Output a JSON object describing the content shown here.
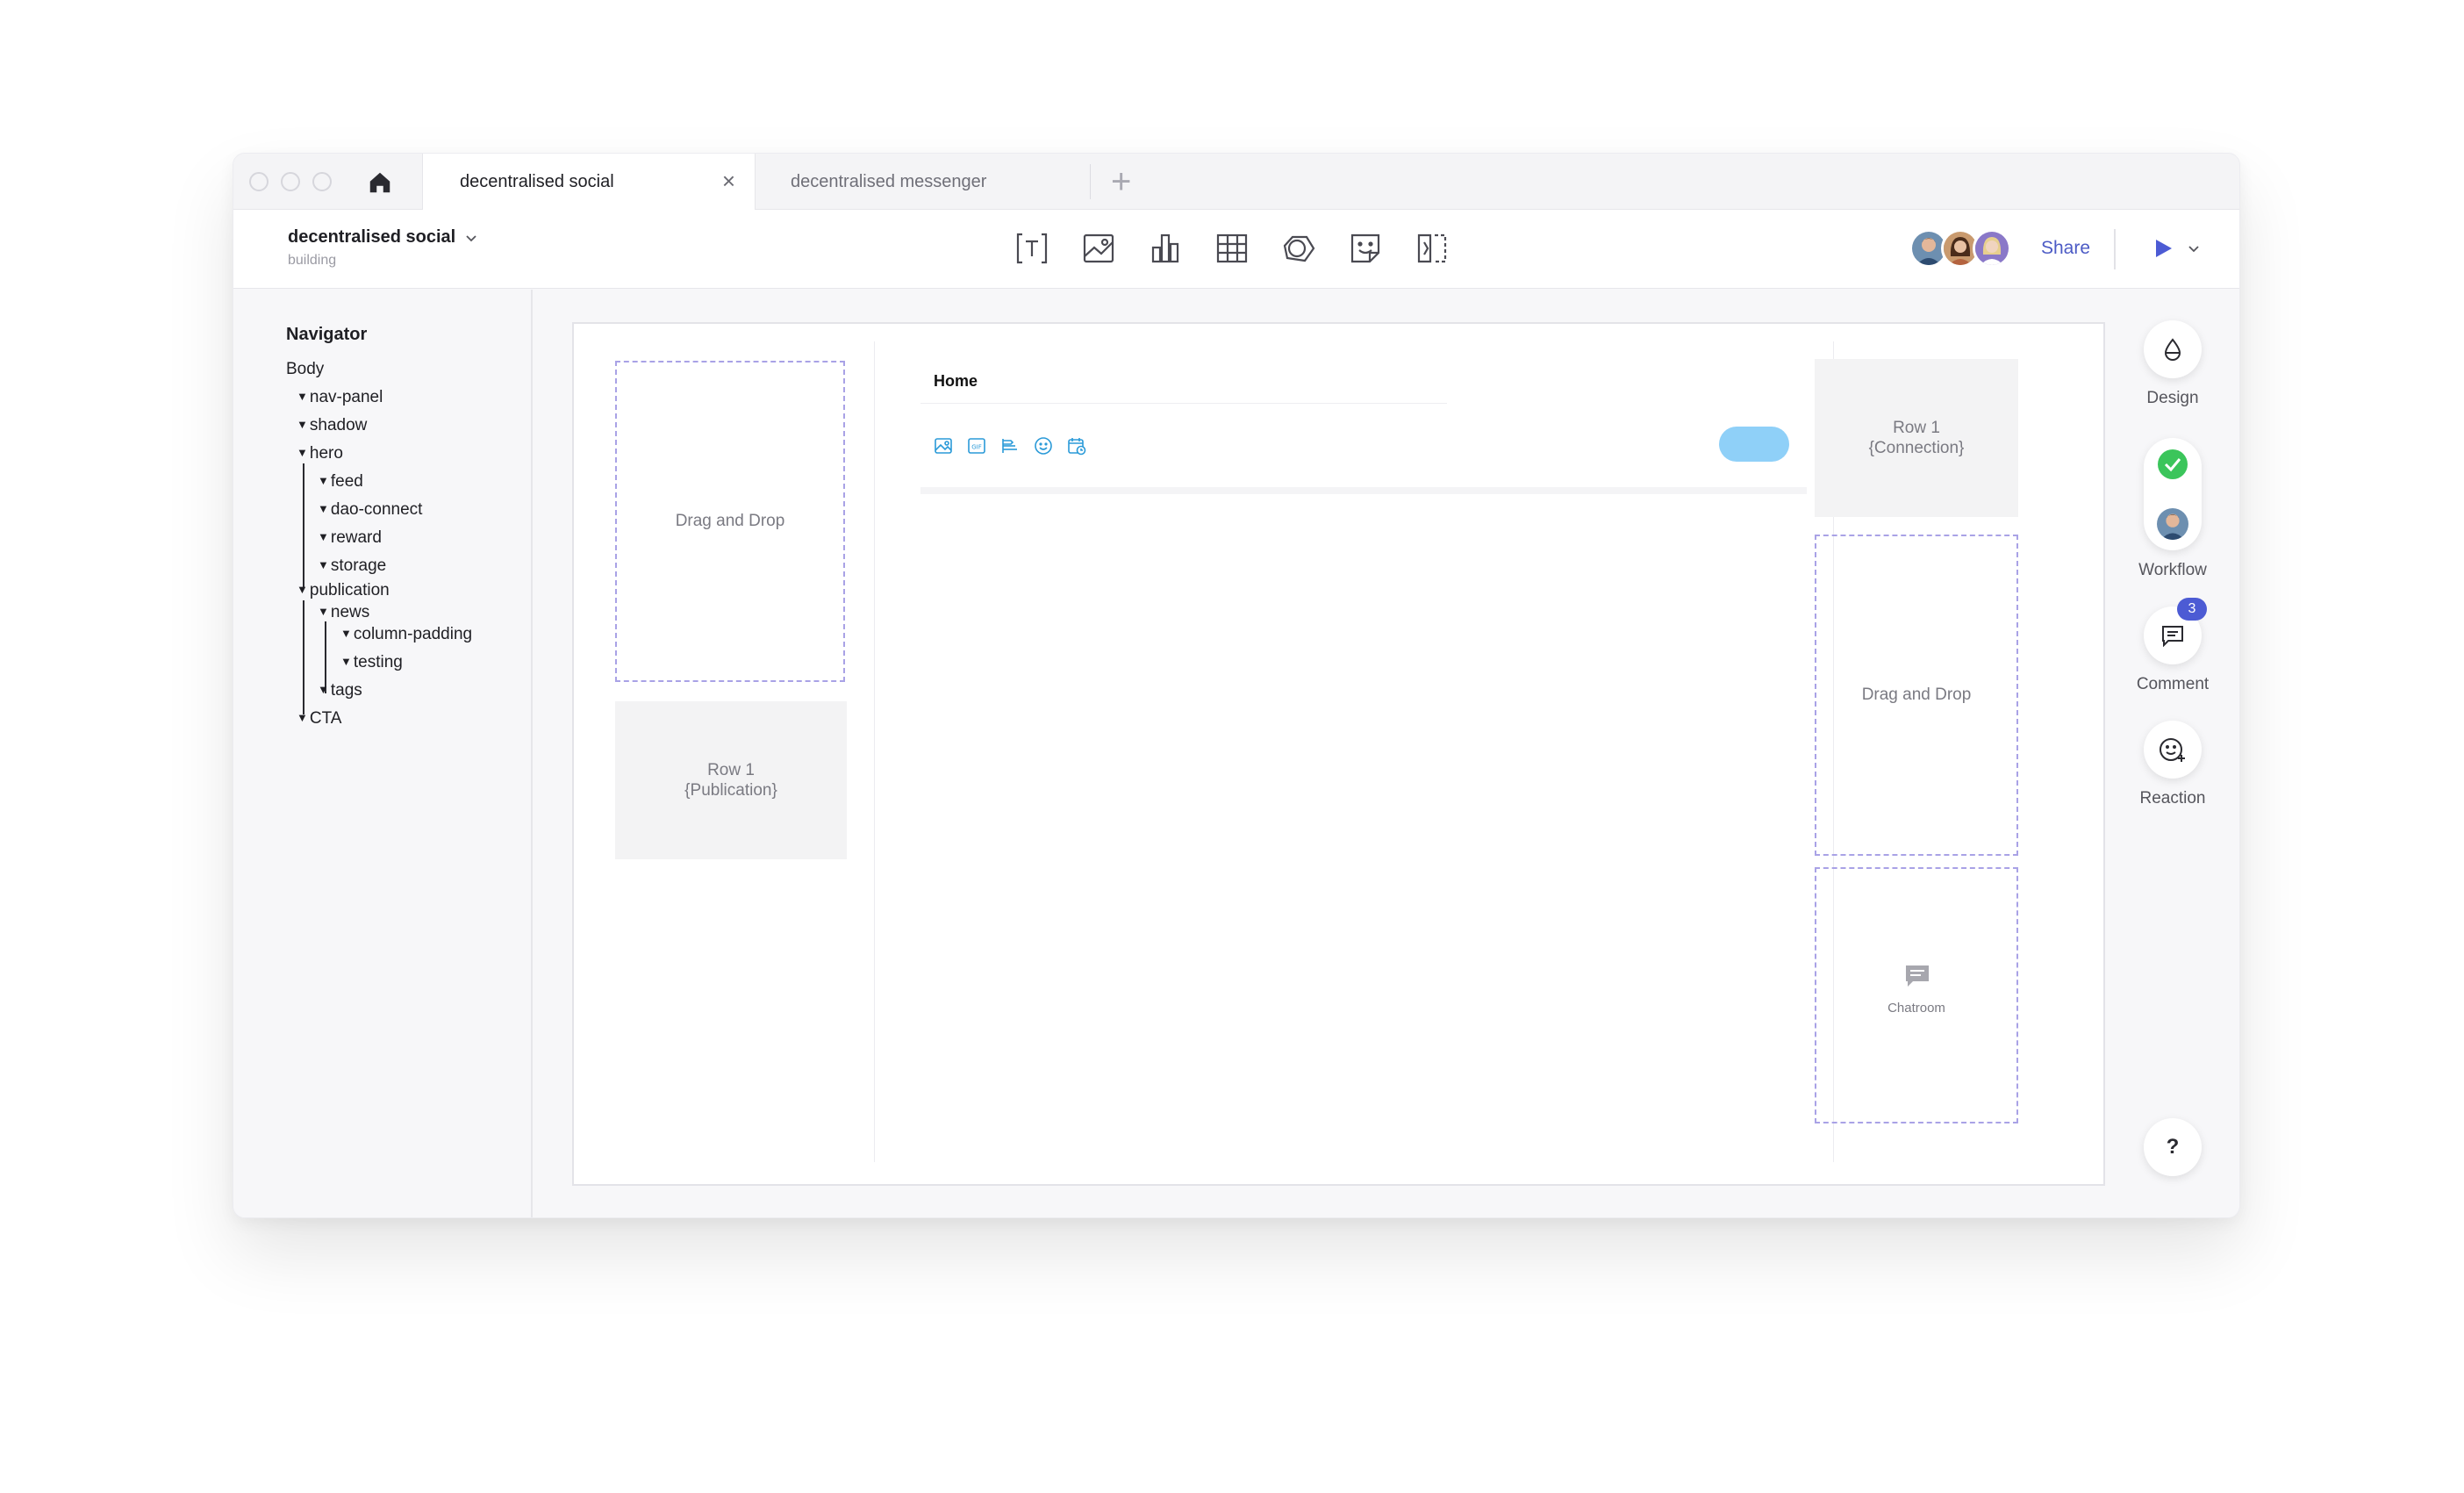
{
  "tabs": {
    "active_label": "decentralised social",
    "inactive_label": "decentralised messenger"
  },
  "project": {
    "title": "decentralised social",
    "subtitle": "building"
  },
  "toolbar": {
    "tools": [
      "text-tool-icon",
      "image-tool-icon",
      "chart-tool-icon",
      "table-tool-icon",
      "shape-tool-icon",
      "sticker-tool-icon",
      "component-tool-icon"
    ],
    "share_label": "Share",
    "accent_color": "#4c5bc5"
  },
  "navigator": {
    "title": "Navigator",
    "nodes": {
      "body": "Body",
      "nav_panel": "nav-panel",
      "shadow": "shadow",
      "hero": "hero",
      "feed": "feed",
      "dao_connect": "dao-connect",
      "reward": "reward",
      "storage": "storage",
      "publication": "publication",
      "news": "news",
      "column_padding": "column-padding",
      "testing": "testing",
      "tags": "tags",
      "cta": "CTA"
    }
  },
  "canvas": {
    "left_dropzone": "Drag and Drop",
    "left_row": [
      "Row 1",
      "{Publication}"
    ],
    "feed_title": "Home",
    "feed_icons": [
      "image-icon",
      "gif-icon",
      "list-icon",
      "emoji-icon",
      "schedule-icon"
    ],
    "right_row": [
      "Row 1",
      "{Connection}"
    ],
    "right_dropzone": "Drag and Drop",
    "chatroom_label": "Chatroom",
    "dropzone_border_color": "#a9a2e6",
    "pill_color": "#8fd0f8"
  },
  "rail": {
    "design_label": "Design",
    "workflow_label": "Workflow",
    "comment_label": "Comment",
    "comment_count": "3",
    "reaction_label": "Reaction",
    "help_label": "?"
  }
}
